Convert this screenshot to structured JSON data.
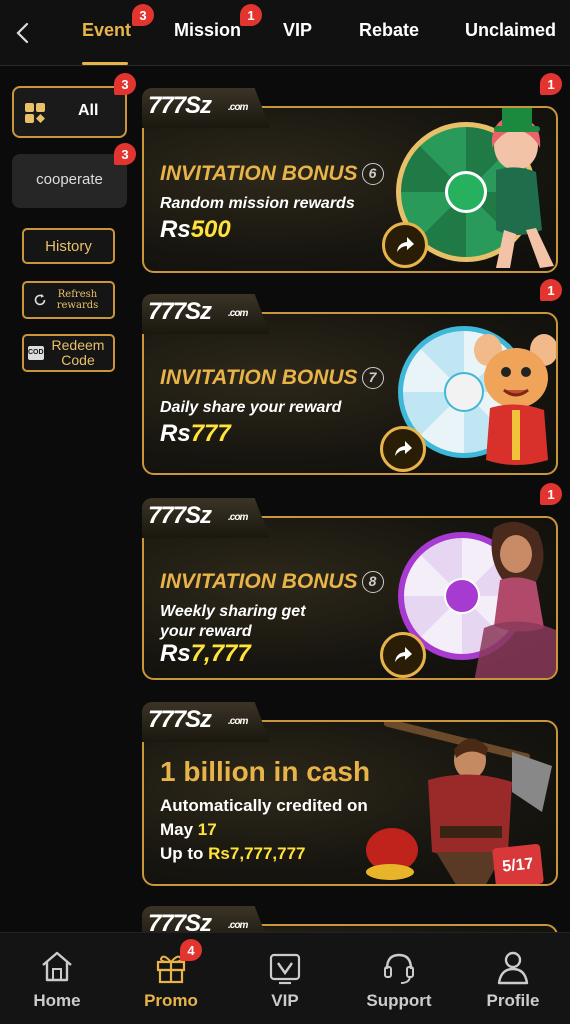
{
  "tabs": [
    {
      "label": "Event",
      "badge": "3",
      "active": true
    },
    {
      "label": "Mission",
      "badge": "1"
    },
    {
      "label": "VIP"
    },
    {
      "label": "Rebate"
    },
    {
      "label": "Unclaimed"
    }
  ],
  "sidebar": {
    "all": {
      "label": "All",
      "badge": "3"
    },
    "cooperate": {
      "label": "cooperate",
      "badge": "3"
    },
    "history": "History",
    "refresh": "Refresh rewards",
    "redeem": "Redeem Code",
    "redeem_icon_text": "CODE"
  },
  "banners": [
    {
      "logo": "777Sz",
      "logo_suffix": ".com",
      "badge": "1",
      "title": "INVITATION BONUS",
      "num": "6",
      "subtitle": "Random mission rewards",
      "currency": "Rs",
      "amount": "500"
    },
    {
      "logo": "777Sz",
      "logo_suffix": ".com",
      "badge": "1",
      "title": "INVITATION BONUS",
      "num": "7",
      "subtitle": "Daily share your reward",
      "currency": "Rs",
      "amount": "777"
    },
    {
      "logo": "777Sz",
      "logo_suffix": ".com",
      "badge": "1",
      "title": "INVITATION BONUS",
      "num": "8",
      "subtitle_line1": "Weekly sharing get",
      "subtitle_line2": "your reward",
      "currency": "Rs",
      "amount": "7,777"
    },
    {
      "logo": "777Sz",
      "logo_suffix": ".com",
      "title": "1 billion in cash",
      "line1": "Automatically credited on",
      "line2_a": "May ",
      "line2_b": "17",
      "line3_a": "Up to ",
      "line3_b": "Rs7,777,777",
      "date_tag": "5/17"
    },
    {
      "logo": "777Sz",
      "logo_suffix": ".com"
    }
  ],
  "bottom_nav": [
    {
      "label": "Home",
      "icon": "home-icon"
    },
    {
      "label": "Promo",
      "icon": "gift-icon",
      "badge": "4",
      "active": true
    },
    {
      "label": "VIP",
      "icon": "vip-icon"
    },
    {
      "label": "Support",
      "icon": "headset-icon"
    },
    {
      "label": "Profile",
      "icon": "user-icon"
    }
  ],
  "colors": {
    "accent": "#e8b44a",
    "badge": "#e2352f",
    "amount": "#ffe23a"
  }
}
